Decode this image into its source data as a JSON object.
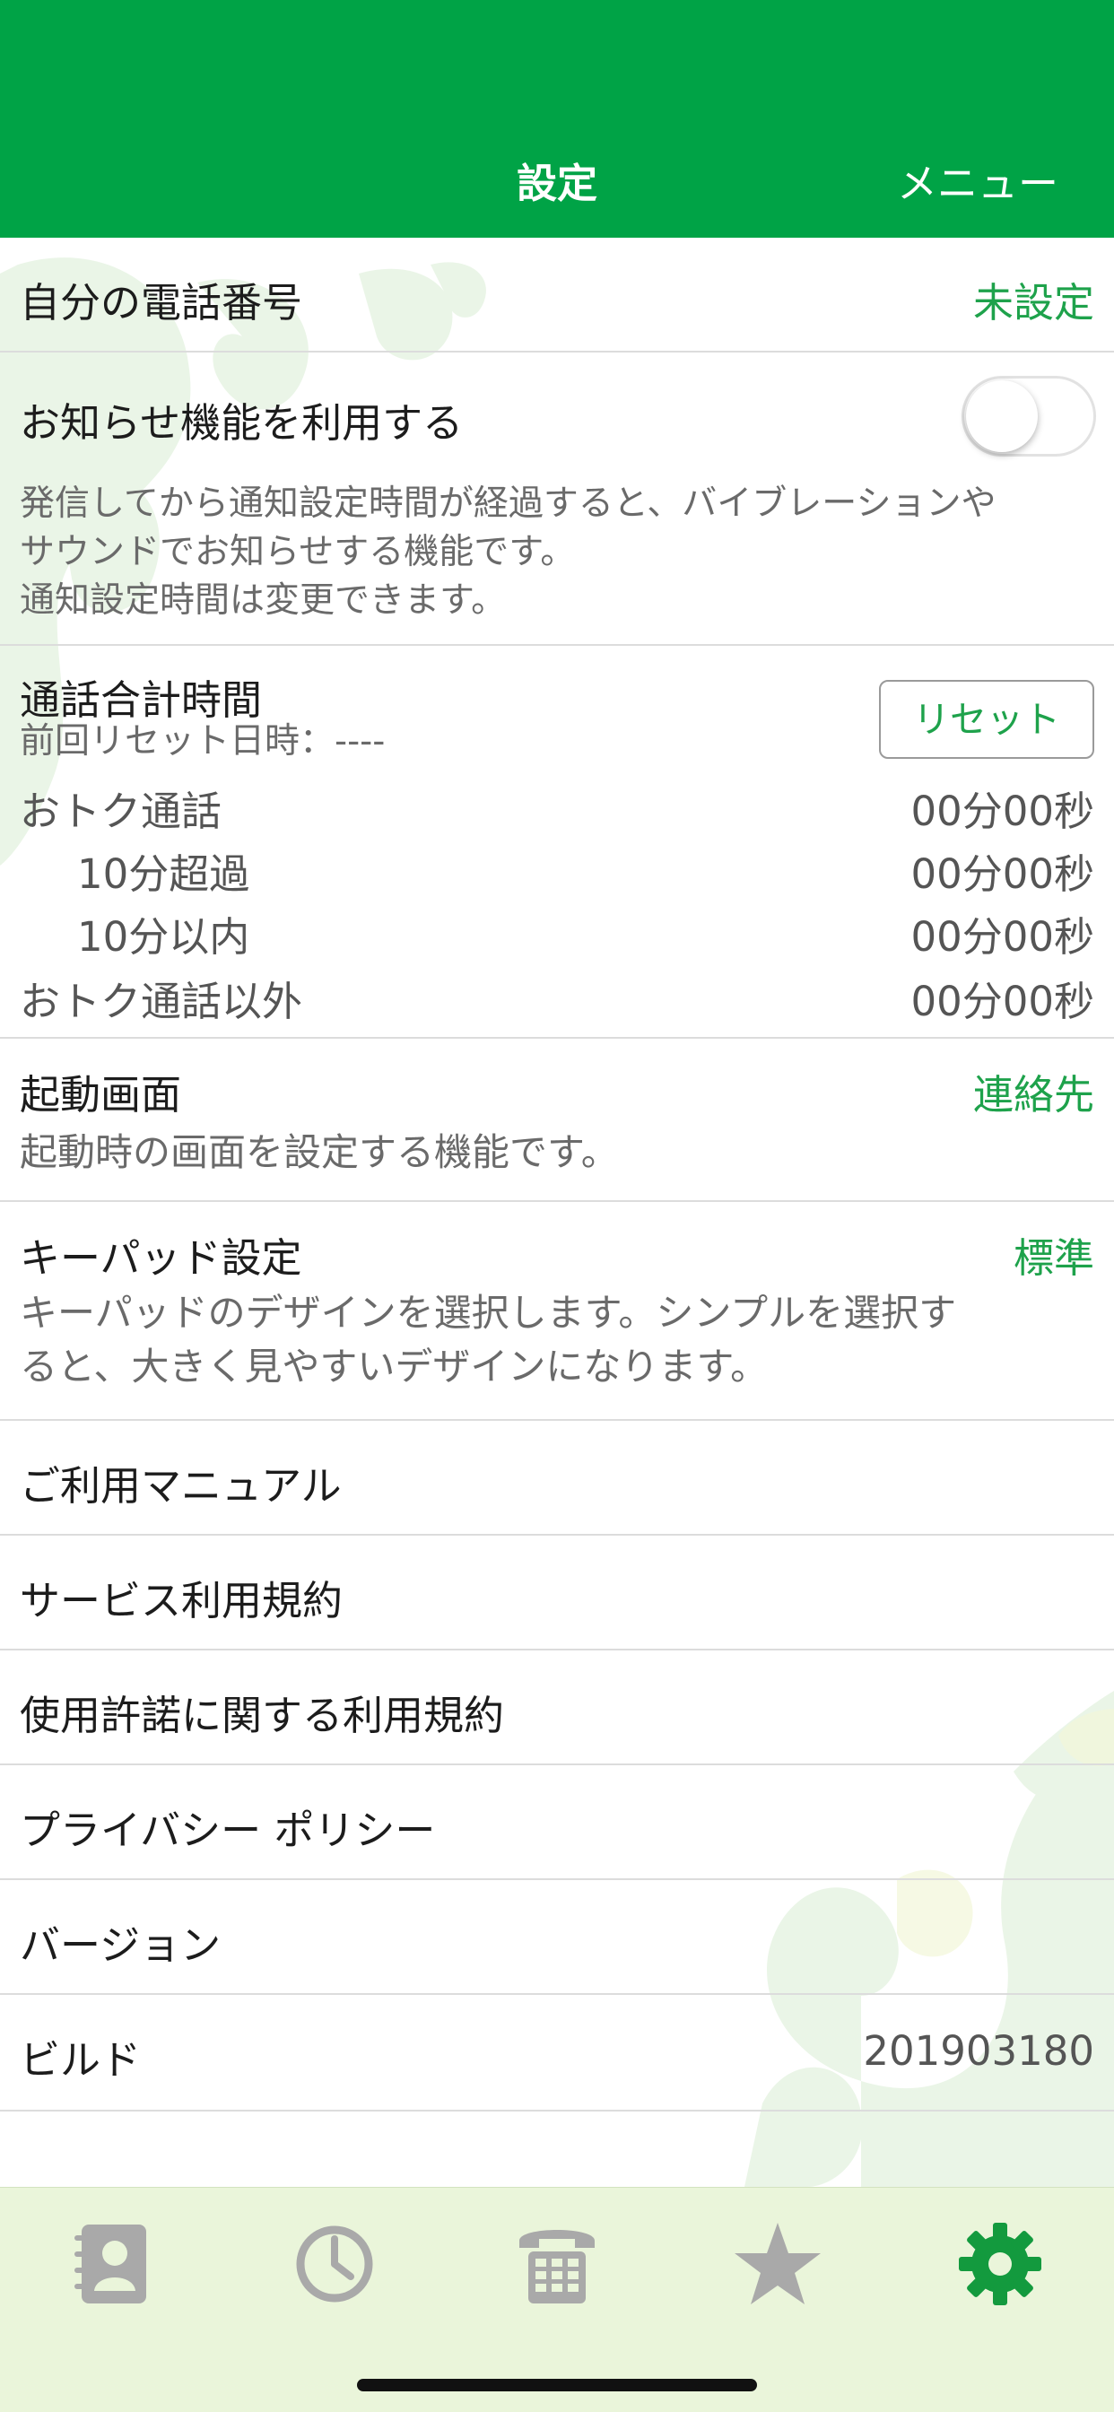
{
  "header": {
    "title": "設定",
    "menu_label": "メニュー"
  },
  "colors": {
    "header_bg": "#00a346",
    "accent_green": "#1ea24b",
    "tabbar_bg": "#eaf5da"
  },
  "settings": {
    "phone_number": {
      "label": "自分の電話番号",
      "value": "未設定"
    },
    "notify": {
      "label": "お知らせ機能を利用する",
      "enabled": false,
      "desc_line1": "発信してから通知設定時間が経過すると、バイブレーションや",
      "desc_line2": "サウンドでお知らせする機能です。",
      "desc_line3": "通知設定時間は変更できます。"
    },
    "call_total": {
      "label": "通話合計時間",
      "last_reset": "前回リセット日時：----",
      "reset_label": "リセット",
      "rows": [
        {
          "label": "おトク通話",
          "value": "00分00秒"
        },
        {
          "label": "10分超過",
          "value": "00分00秒"
        },
        {
          "label": "10分以内",
          "value": "00分00秒"
        },
        {
          "label": "おトク通話以外",
          "value": "00分00秒"
        }
      ]
    },
    "startup": {
      "label": "起動画面",
      "value": "連絡先",
      "desc": "起動時の画面を設定する機能です。"
    },
    "keypad": {
      "label": "キーパッド設定",
      "value": "標準",
      "desc_line1": "キーパッドのデザインを選択します。シンプルを選択す",
      "desc_line2": "ると、大きく見やすいデザインになります。"
    },
    "manual": {
      "label": "ご利用マニュアル"
    },
    "service_terms": {
      "label": "サービス利用規約"
    },
    "license_terms": {
      "label": "使用許諾に関する利用規約"
    },
    "privacy": {
      "label": "プライバシー ポリシー"
    },
    "version": {
      "label": "バージョン",
      "value": ""
    },
    "build": {
      "label": "ビルド",
      "value": "201903180"
    }
  },
  "tabbar": {
    "items": [
      {
        "icon": "contacts-icon",
        "active": false
      },
      {
        "icon": "history-clock-icon",
        "active": false
      },
      {
        "icon": "keypad-phone-icon",
        "active": false
      },
      {
        "icon": "favorites-star-icon",
        "active": false
      },
      {
        "icon": "settings-gear-icon",
        "active": true
      }
    ]
  }
}
